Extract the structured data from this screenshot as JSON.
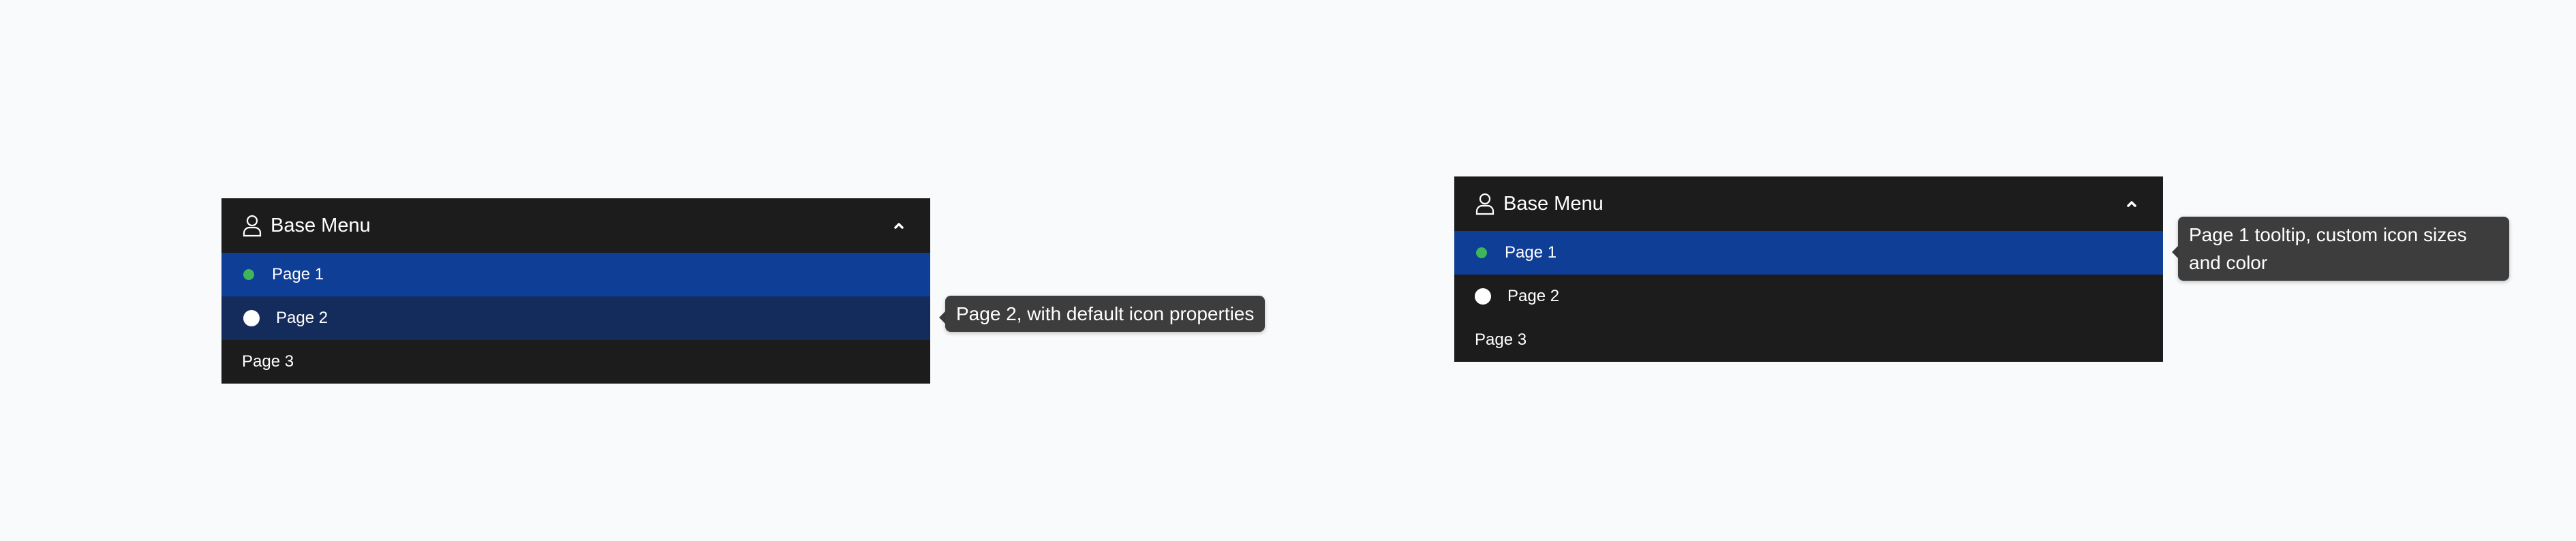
{
  "menus": [
    {
      "title": "Base Menu",
      "header_icon": "person-icon",
      "toggle_icon": "chevron-up-icon",
      "items": [
        {
          "label": "Page 1",
          "icon": "green-dot",
          "state": "selected"
        },
        {
          "label": "Page 2",
          "icon": "white-dot",
          "state": "hover"
        },
        {
          "label": "Page 3",
          "icon": "",
          "state": "default"
        }
      ],
      "tooltip": "Page 2, with default icon properties"
    },
    {
      "title": "Base Menu",
      "header_icon": "person-icon",
      "toggle_icon": "chevron-up-icon",
      "items": [
        {
          "label": "Page 1",
          "icon": "green-dot",
          "state": "selected"
        },
        {
          "label": "Page 2",
          "icon": "white-dot",
          "state": "default"
        },
        {
          "label": "Page 3",
          "icon": "",
          "state": "default"
        }
      ],
      "tooltip": "Page 1 tooltip, custom icon sizes and color"
    }
  ],
  "colors": {
    "background": "#f9fafc",
    "menu_bg": "#1c1c1c",
    "selected_bg": "#0f3e96",
    "hover_bg": "#142c5c",
    "dot_green": "#3fb55a",
    "tooltip_bg": "#3d3d3d"
  }
}
